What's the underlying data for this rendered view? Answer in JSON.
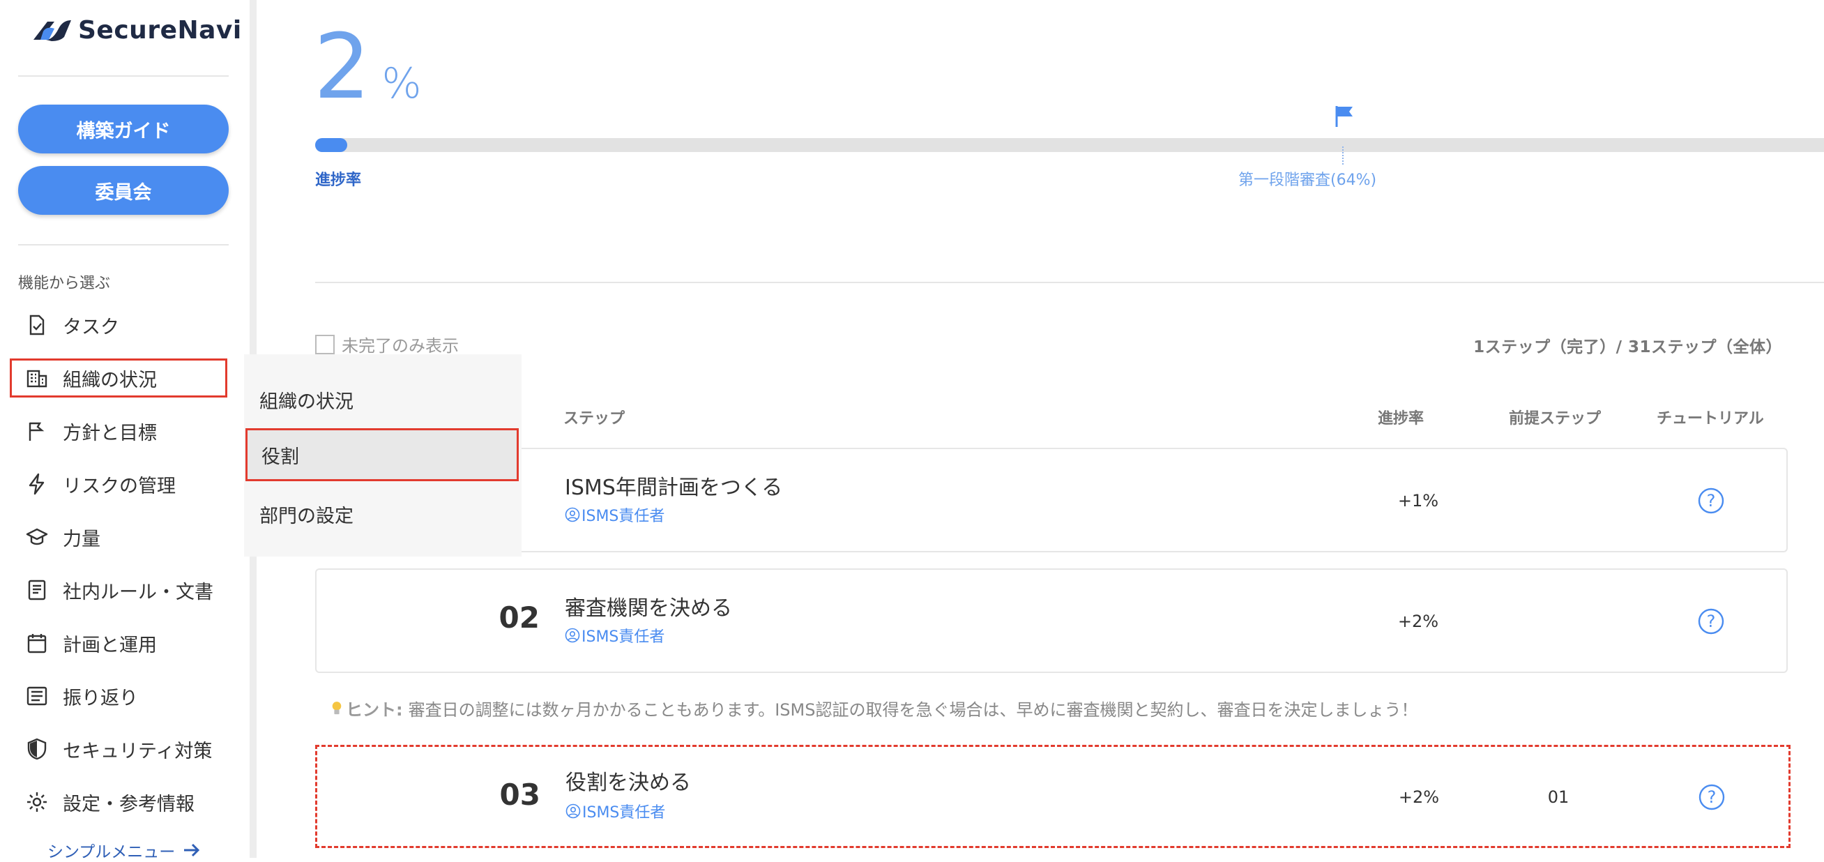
{
  "app": {
    "logo_text": "SecureNavi"
  },
  "sidebar": {
    "guide_button": "構築ガイド",
    "committee_button": "委員会",
    "section_label": "機能から選ぶ",
    "items": [
      {
        "label": "タスク",
        "icon": "task-check-icon"
      },
      {
        "label": "組織の状況",
        "icon": "building-icon"
      },
      {
        "label": "方針と目標",
        "icon": "flag-icon"
      },
      {
        "label": "リスクの管理",
        "icon": "lightning-icon"
      },
      {
        "label": "力量",
        "icon": "graduation-cap-icon"
      },
      {
        "label": "社内ルール・文書",
        "icon": "document-icon"
      },
      {
        "label": "計画と運用",
        "icon": "calendar-icon"
      },
      {
        "label": "振り返り",
        "icon": "list-icon"
      },
      {
        "label": "セキュリティ対策",
        "icon": "shield-icon"
      },
      {
        "label": "設定・参考情報",
        "icon": "gear-icon"
      }
    ],
    "active_index": 1,
    "simple_menu": "シンプルメニュー"
  },
  "submenu": {
    "items": [
      "組織の状況",
      "役割",
      "部門の設定"
    ],
    "selected_index": 1
  },
  "progress": {
    "value": "2",
    "unit": "%",
    "fraction": 0.02,
    "label": "進捗率",
    "milestone_label": "第一段階審査(64%)",
    "milestone_fraction": 0.64
  },
  "filter": {
    "incomplete_only_label": "未完了のみ表示",
    "checked": false
  },
  "step_count": "1ステップ（完了）/ 31ステップ（全体）",
  "table": {
    "headers": {
      "step": "ステップ",
      "progress": "進捗率",
      "prereq": "前提ステップ",
      "tutorial": "チュートリアル"
    },
    "rows": [
      {
        "num": "",
        "title": "ISMS年間計画をつくる",
        "role": "ISMS責任者",
        "progress": "+1%",
        "prereq": ""
      },
      {
        "num": "02",
        "title": "審査機関を決める",
        "role": "ISMS責任者",
        "progress": "+2%",
        "prereq": ""
      },
      {
        "num": "03",
        "title": "役割を決める",
        "role": "ISMS責任者",
        "progress": "+2%",
        "prereq": "01"
      }
    ]
  },
  "hint": {
    "label": "ヒント:",
    "text": "審査日の調整には数ヶ月かかることもあります。ISMS認証の取得を急ぐ場合は、早めに審査機関と契約し、審査日を決定しましょう！"
  },
  "colors": {
    "accent": "#4a8cf0",
    "highlight_border": "#e23b2e",
    "big_percent": "#6fa3ec"
  }
}
